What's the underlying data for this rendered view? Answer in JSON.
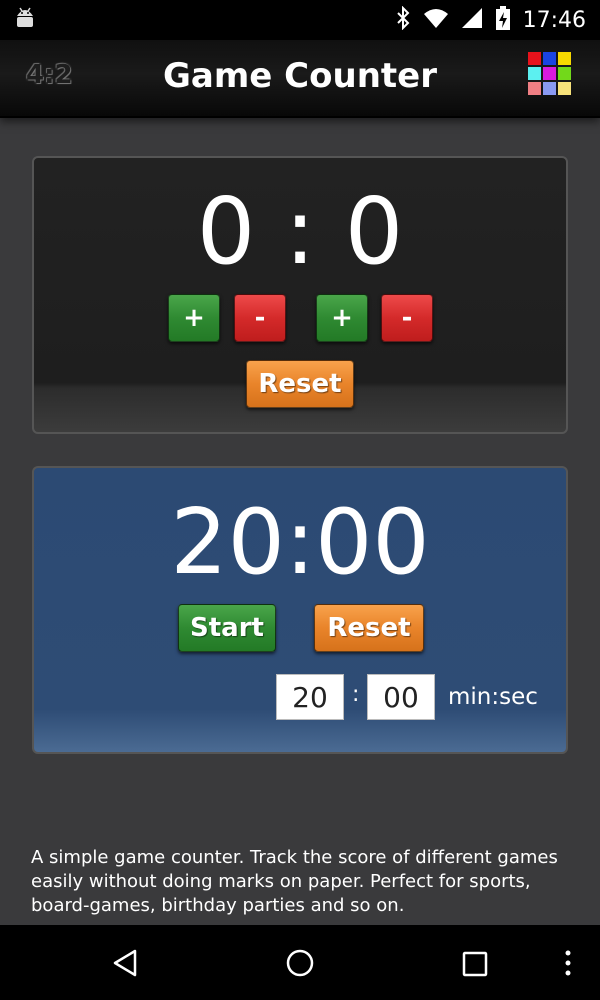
{
  "status_bar": {
    "time": "17:46",
    "icons": [
      "android-icon",
      "bluetooth-icon",
      "wifi-icon",
      "signal-icon",
      "battery-charging-icon"
    ]
  },
  "app_bar": {
    "icon_text": "4:2",
    "title": "Game Counter",
    "color_grid": [
      "#e8121b",
      "#1a44e3",
      "#f7d900",
      "#5cf0f0",
      "#d91adf",
      "#72d91a",
      "#f07f84",
      "#8a9af2",
      "#f7e27a"
    ]
  },
  "score": {
    "display": "0 : 0",
    "plus_label": "+",
    "minus_label": "-",
    "reset_label": "Reset"
  },
  "timer": {
    "display": "20:00",
    "start_label": "Start",
    "reset_label": "Reset",
    "minutes_value": "20",
    "separator": ":",
    "seconds_value": "00",
    "unit_label": "min:sec"
  },
  "description": "A simple game counter. Track the score of different games easily without doing marks on paper. Perfect for sports, board-games, birthday parties and so on.",
  "colors": {
    "background": "#3a3a3c",
    "timer_panel": "#2e4c75",
    "green": "#2f8a32",
    "red": "#d42a2a",
    "orange": "#e9842a"
  }
}
